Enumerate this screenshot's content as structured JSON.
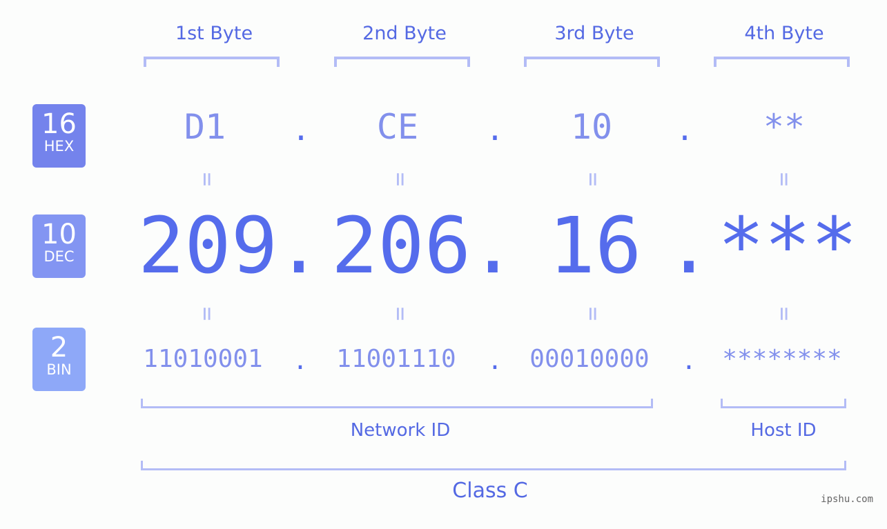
{
  "bytes": [
    {
      "label": "1st Byte",
      "hex": "D1",
      "dec": "209",
      "bin": "11010001"
    },
    {
      "label": "2nd Byte",
      "hex": "CE",
      "dec": "206",
      "bin": "11001110"
    },
    {
      "label": "3rd Byte",
      "hex": "10",
      "dec": "16",
      "bin": "00010000"
    },
    {
      "label": "4th Byte",
      "hex": "**",
      "dec": "***",
      "bin": "********"
    }
  ],
  "separator": ".",
  "equals": "=",
  "badges": {
    "hex": {
      "num": "16",
      "label": "HEX",
      "color": "#7483ec"
    },
    "dec": {
      "num": "10",
      "label": "DEC",
      "color": "#8395f2"
    },
    "bin": {
      "num": "2",
      "label": "BIN",
      "color": "#8ea8f8"
    }
  },
  "network_id_label": "Network ID",
  "host_id_label": "Host ID",
  "class_label": "Class C",
  "credit": "ipshu.com",
  "colors": {
    "primary": "#556cec",
    "light": "#8290ec",
    "bracket": "#b3bcf6"
  }
}
